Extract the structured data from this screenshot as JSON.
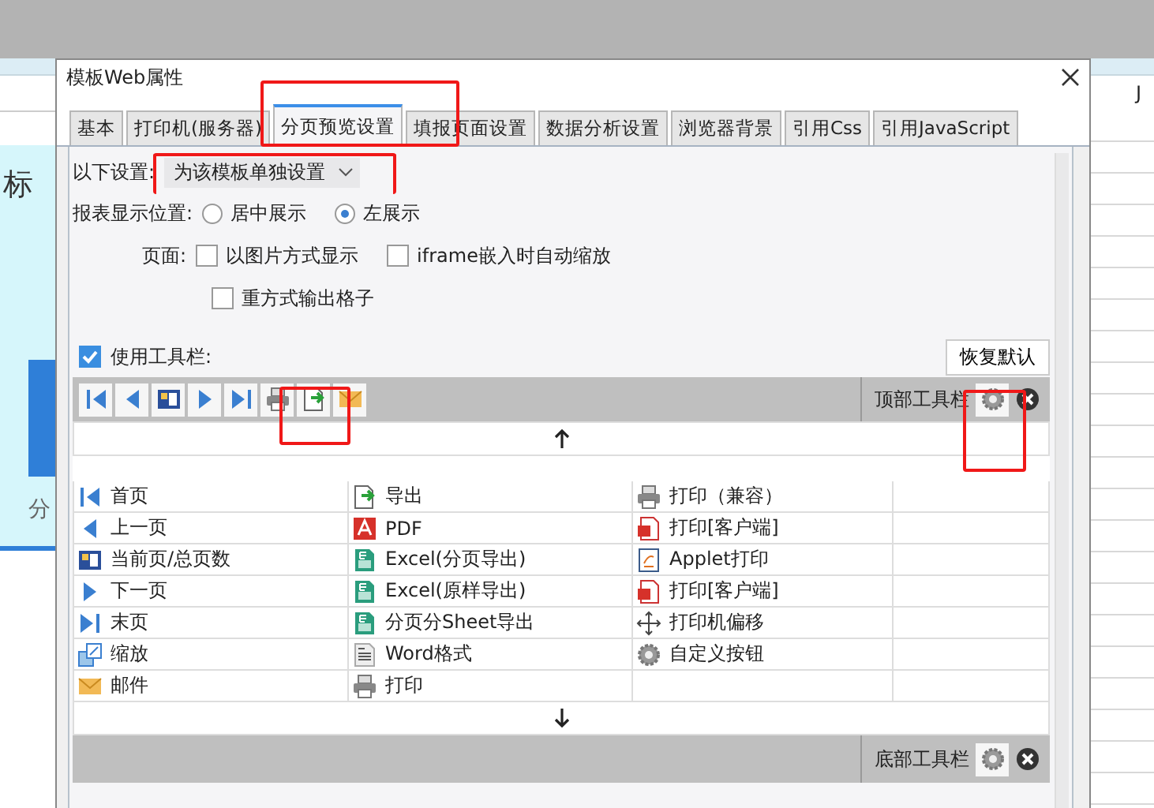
{
  "background": {
    "column_header": "J",
    "title_fragment": "标",
    "cell_fragment": "分"
  },
  "dialog": {
    "title": "模板Web属性"
  },
  "tabs": [
    {
      "label": "基本",
      "selected": false
    },
    {
      "label": "打印机(服务器)",
      "selected": false
    },
    {
      "label": "分页预览设置",
      "selected": true
    },
    {
      "label": "填报页面设置",
      "selected": false
    },
    {
      "label": "数据分析设置",
      "selected": false
    },
    {
      "label": "浏览器背景",
      "selected": false
    },
    {
      "label": "引用Css",
      "selected": false
    },
    {
      "label": "引用JavaScript",
      "selected": false
    }
  ],
  "scope": {
    "label": "以下设置:",
    "value": "为该模板单独设置"
  },
  "position": {
    "label": "报表显示位置:",
    "options": [
      {
        "label": "居中展示",
        "selected": false
      },
      {
        "label": "左展示",
        "selected": true
      }
    ]
  },
  "page": {
    "label": "页面:",
    "options": [
      {
        "label": "以图片方式显示",
        "checked": false
      },
      {
        "label": "iframe嵌入时自动缩放",
        "checked": false
      },
      {
        "label": "重方式输出格子",
        "checked": false
      }
    ]
  },
  "use_toolbar": {
    "label": "使用工具栏:",
    "checked": true
  },
  "restore_button": "恢复默认",
  "top_toolbar": {
    "label": "顶部工具栏"
  },
  "bottom_toolbar": {
    "label": "底部工具栏"
  },
  "button_grid": [
    [
      "首页",
      "导出",
      "打印（兼容）"
    ],
    [
      "上一页",
      "PDF",
      "打印[客户端]"
    ],
    [
      "当前页/总页数",
      "Excel(分页导出)",
      "Applet打印"
    ],
    [
      "下一页",
      "Excel(原样导出)",
      "打印[客户端]"
    ],
    [
      "末页",
      "分页分Sheet导出",
      "打印机偏移"
    ],
    [
      "缩放",
      "Word格式",
      "自定义按钮"
    ],
    [
      "邮件",
      "打印"
    ]
  ]
}
